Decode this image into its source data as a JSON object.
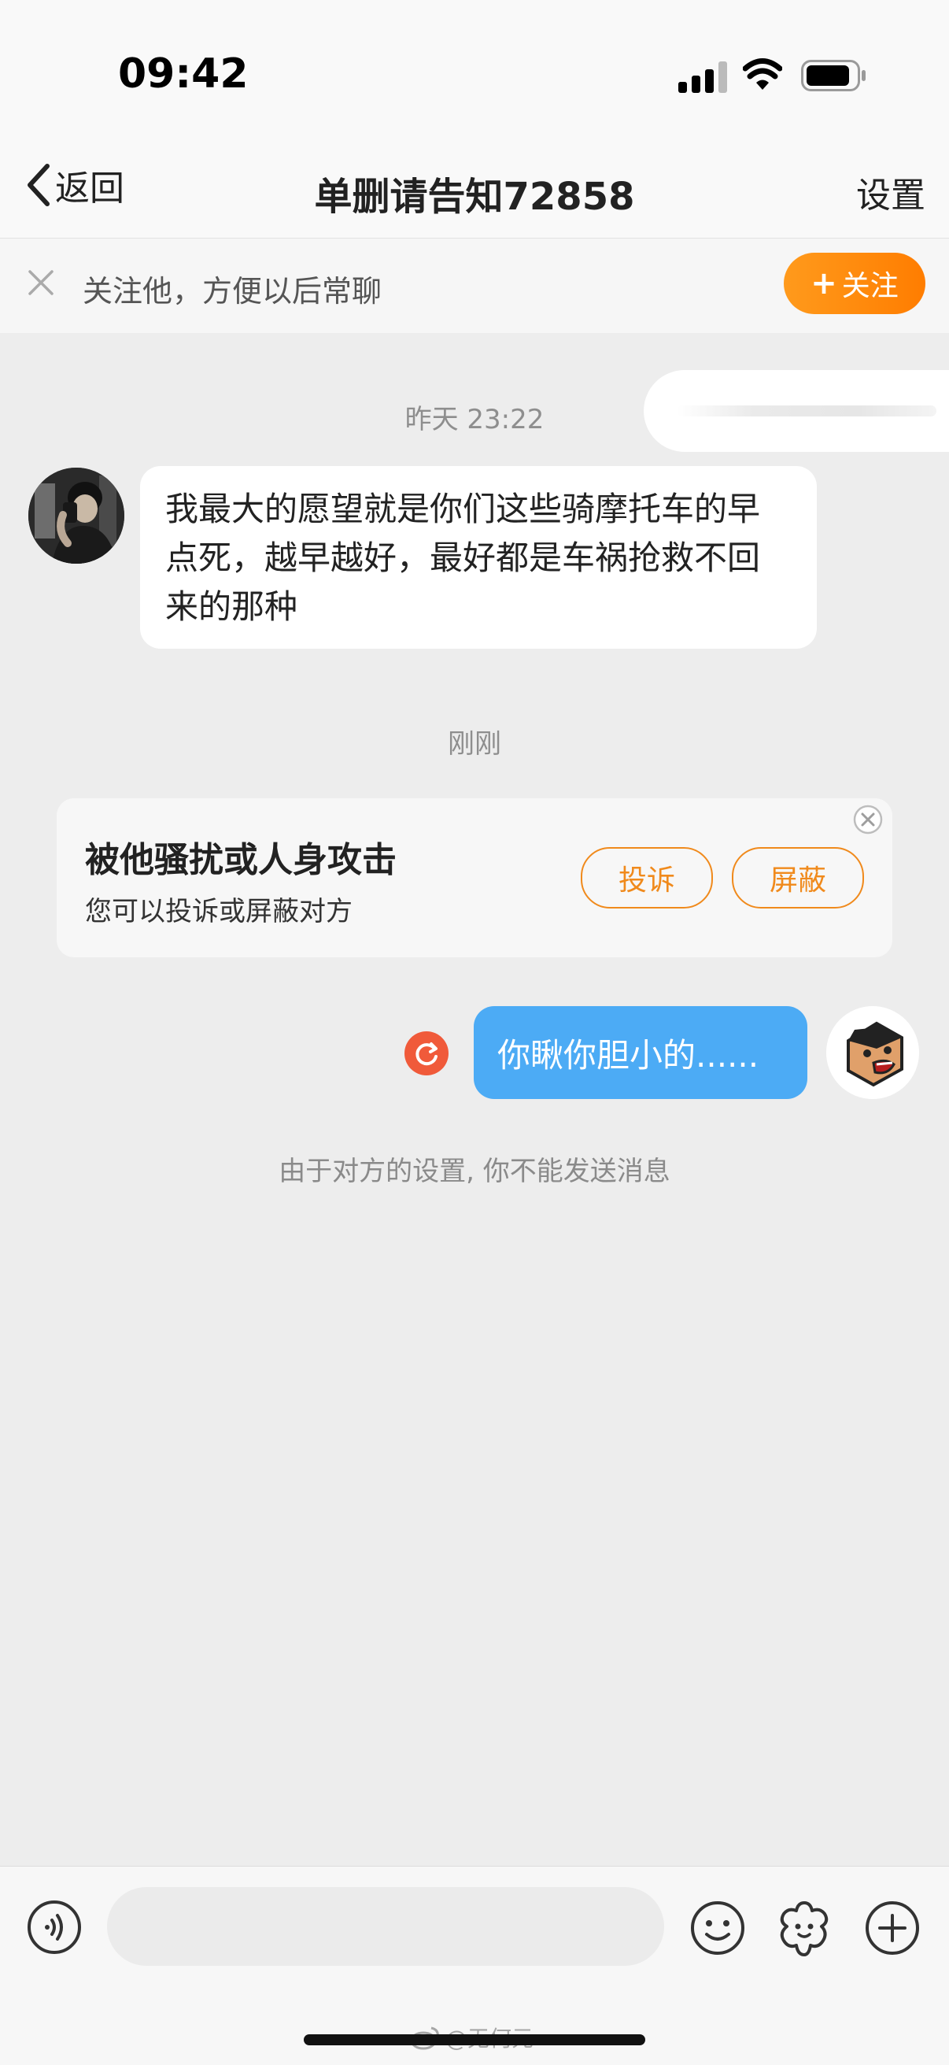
{
  "status_bar": {
    "time": "09:42"
  },
  "nav": {
    "back_label": "返回",
    "title": "单删请告知72858",
    "settings_label": "设置"
  },
  "follow_bar": {
    "text": "关注他，方便以后常聊",
    "button_plus": "+",
    "button_label": "关注"
  },
  "chat": {
    "timestamp_1": "昨天 23:22",
    "peer_message": "我最大的愿望就是你们这些骑摩托车的早点死，越早越好，最好都是车祸抢救不回来的那种",
    "timestamp_2": "刚刚",
    "harass_card": {
      "title": "被他骚扰或人身攻击",
      "subtitle": "您可以投诉或屏蔽对方",
      "report_label": "投诉",
      "block_label": "屏蔽"
    },
    "my_message": "你瞅你胆小的......",
    "system_notice": "由于对方的设置, 你不能发送消息"
  },
  "input_bar": {
    "placeholder": ""
  },
  "watermark": "@无何元",
  "colors": {
    "accent_orange": "#ff8a00",
    "my_bubble": "#4cabf5",
    "retry_red": "#f05a3a",
    "background": "#ededed"
  },
  "icons": {
    "back": "chevron-left-icon",
    "close": "close-icon",
    "retry": "refresh-icon",
    "voice": "voice-icon",
    "emoji": "emoji-icon",
    "sticker": "sticker-icon",
    "plus": "plus-icon"
  }
}
